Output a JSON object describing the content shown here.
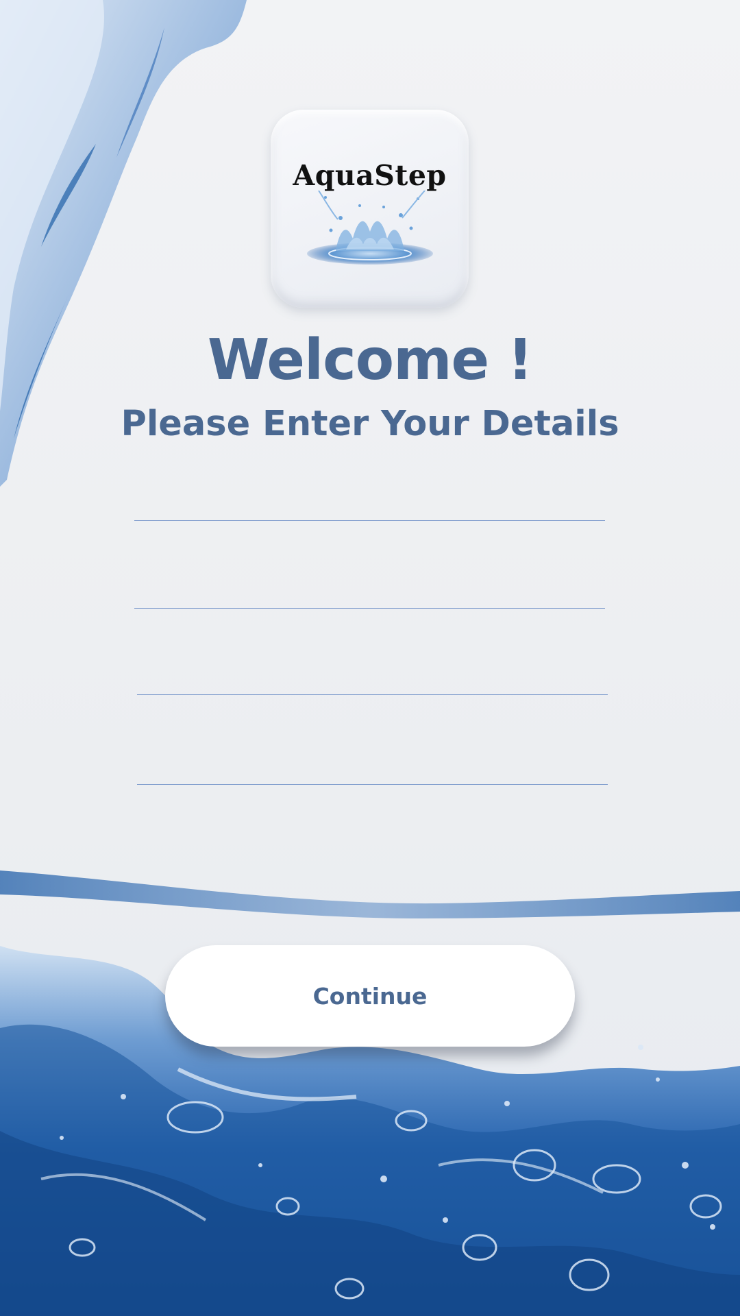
{
  "app": {
    "logo_text": "AquaStep"
  },
  "header": {
    "title": "Welcome !",
    "subtitle": "Please Enter Your Details"
  },
  "form": {
    "fields": [
      {
        "value": "",
        "placeholder": ""
      },
      {
        "value": "",
        "placeholder": ""
      },
      {
        "value": "",
        "placeholder": ""
      },
      {
        "value": "",
        "placeholder": ""
      }
    ]
  },
  "actions": {
    "continue_label": "Continue"
  },
  "colors": {
    "accent": "#4a6891",
    "field_line": "#7f9ccd",
    "background": "#eeeff1",
    "water_blue": "#1f5fa6"
  },
  "icons": {
    "background": "water-splash-background",
    "logo_splash": "water-splash-icon"
  }
}
